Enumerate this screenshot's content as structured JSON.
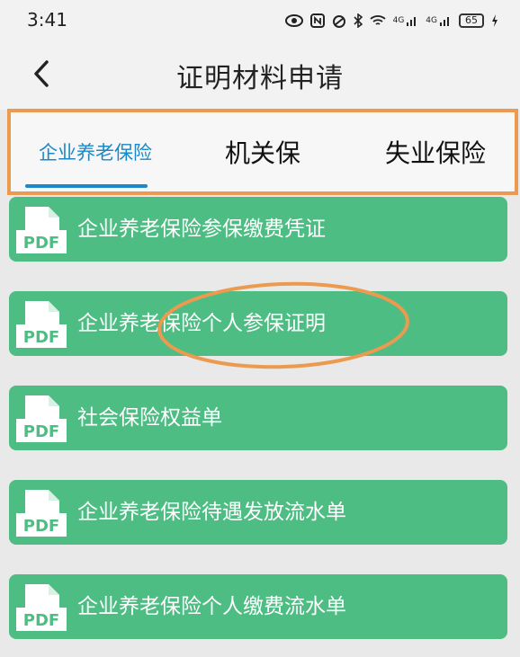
{
  "status_bar": {
    "time": "3:41",
    "network_label_1": "4G",
    "network_label_2": "4G",
    "battery": "65",
    "icons": [
      "eye-icon",
      "nfc-icon",
      "alarm-icon",
      "bluetooth-icon",
      "wifi-icon",
      "signal-icon",
      "signal-icon",
      "battery-icon",
      "charging-icon"
    ]
  },
  "header": {
    "title": "证明材料申请",
    "back_icon": "chevron-left-icon"
  },
  "tabs": [
    {
      "label": "企业养老保险",
      "active": true
    },
    {
      "label": "机关保",
      "active": false
    },
    {
      "label": "失业保险",
      "active": false
    }
  ],
  "items": [
    {
      "label": "企业养老保险参保缴费凭证",
      "icon_text": "PDF"
    },
    {
      "label": "企业养老保险个人参保证明",
      "icon_text": "PDF"
    },
    {
      "label": "社会保险权益单",
      "icon_text": "PDF"
    },
    {
      "label": "企业养老保险待遇发放流水单",
      "icon_text": "PDF"
    },
    {
      "label": "企业养老保险个人缴费流水单",
      "icon_text": "PDF"
    }
  ],
  "colors": {
    "accent": "#1b88c7",
    "item_bg": "#4dbd83",
    "highlight_border": "#ec9a50",
    "page_bg": "#e9e9e9"
  }
}
